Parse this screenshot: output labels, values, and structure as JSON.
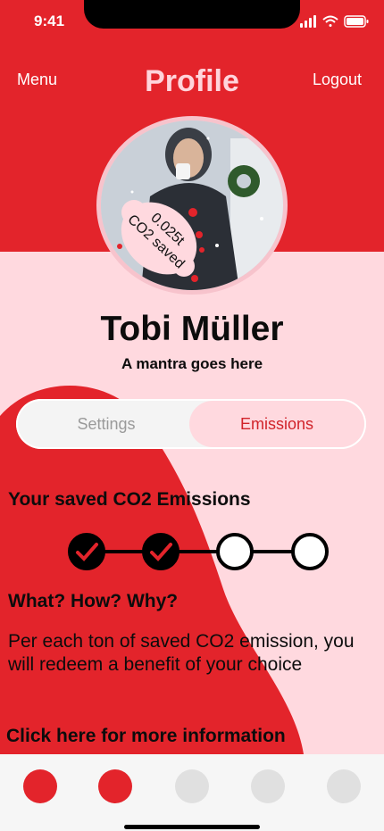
{
  "status_bar": {
    "time": "9:41"
  },
  "header": {
    "menu_label": "Menu",
    "title": "Profile",
    "logout_label": "Logout"
  },
  "avatar": {
    "bubble_value": "0.025t",
    "bubble_label": "CO2 saved"
  },
  "user": {
    "name": "Tobi Müller",
    "mantra": "A mantra goes here"
  },
  "tabs": [
    {
      "label": "Settings",
      "selected": false
    },
    {
      "label": "Emissions",
      "selected": true
    }
  ],
  "emissions": {
    "heading": "Your saved CO2 Emissions",
    "progress_steps_total": 4,
    "progress_steps_completed": 2
  },
  "info": {
    "heading": "What? How? Why?",
    "body": "Per each ton of saved CO2 emission, you will redeem a benefit of your choice",
    "link_label": "Click here for more information"
  },
  "bottom_nav": {
    "items_total": 5,
    "active_items": 2
  },
  "colors": {
    "brand_red": "#e3242b",
    "light_pink": "#ffd9df",
    "inactive_gray": "#e0e0e0"
  }
}
